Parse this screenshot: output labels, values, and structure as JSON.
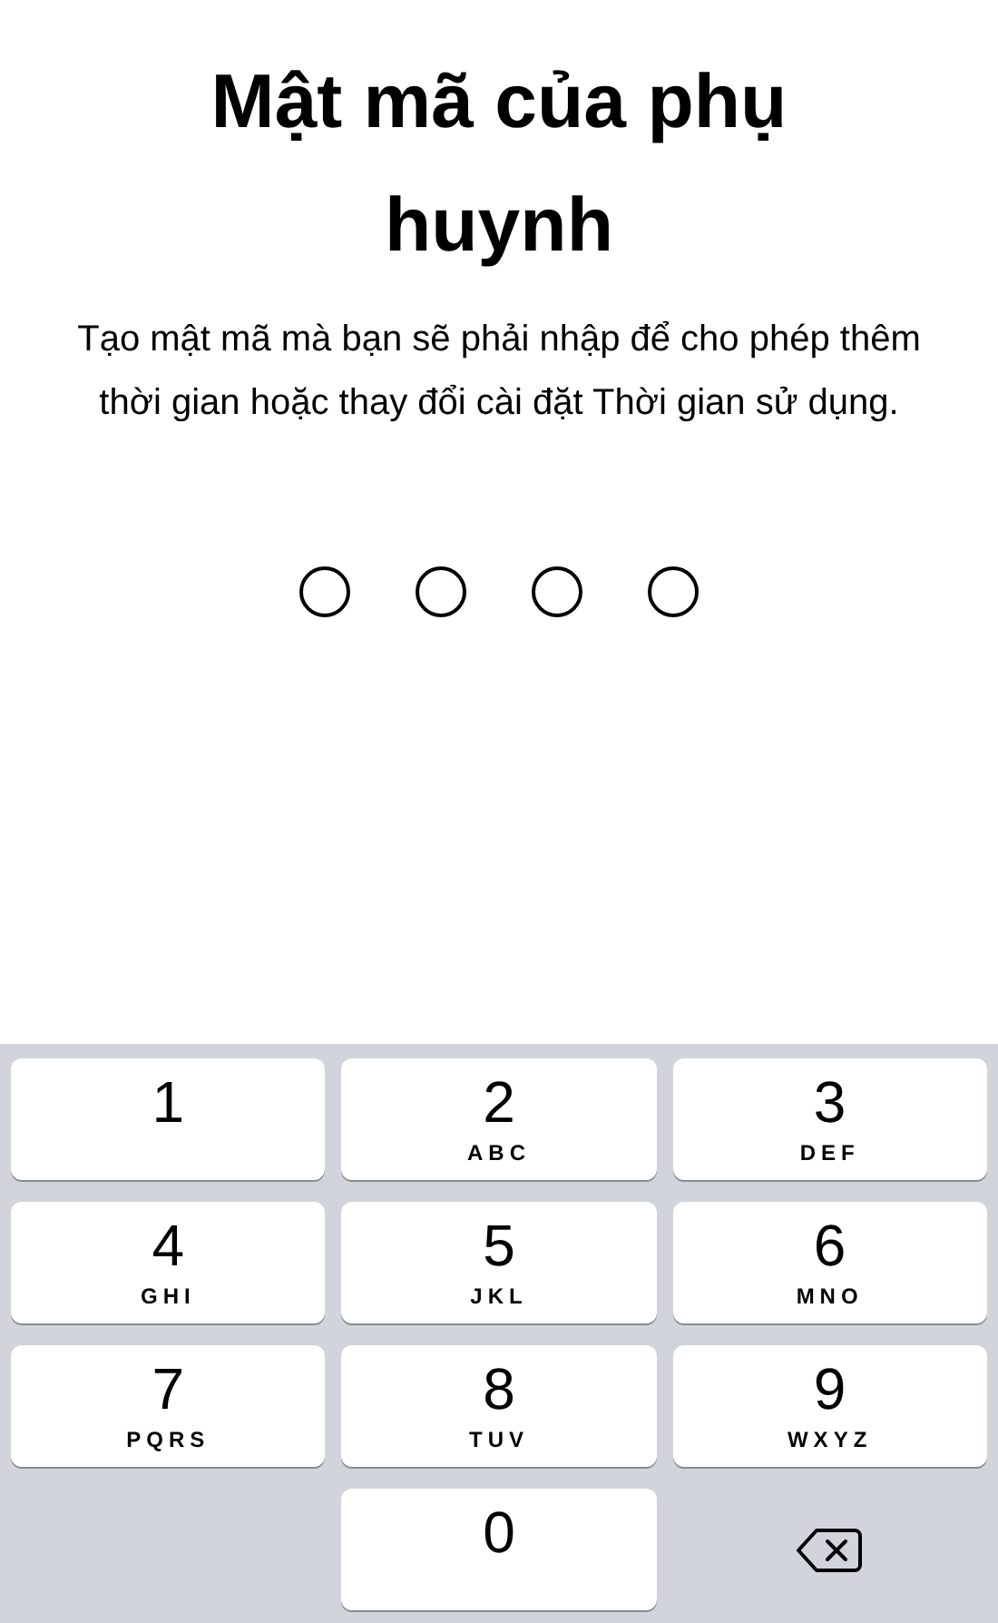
{
  "title": "Mật mã của phụ huynh",
  "description": "Tạo mật mã mà bạn sẽ phải nhập để cho phép thêm thời gian hoặc thay đổi cài đặt Thời gian sử dụng.",
  "passcode_dots": [
    {
      "filled": false
    },
    {
      "filled": false
    },
    {
      "filled": false
    },
    {
      "filled": false
    }
  ],
  "keypad": [
    {
      "kind": "digit",
      "digit": "1"
    },
    {
      "kind": "digit",
      "digit": "2",
      "letters": "ABC"
    },
    {
      "kind": "digit",
      "digit": "3",
      "letters": "DEF"
    },
    {
      "kind": "digit",
      "digit": "4",
      "letters": "GHI"
    },
    {
      "kind": "digit",
      "digit": "5",
      "letters": "JKL"
    },
    {
      "kind": "digit",
      "digit": "6",
      "letters": "MNO"
    },
    {
      "kind": "digit",
      "digit": "7",
      "letters": "PQRS"
    },
    {
      "kind": "digit",
      "digit": "8",
      "letters": "TUV"
    },
    {
      "kind": "digit",
      "digit": "9",
      "letters": "WXYZ"
    },
    {
      "kind": "blank"
    },
    {
      "kind": "digit",
      "digit": "0"
    },
    {
      "kind": "delete"
    }
  ]
}
